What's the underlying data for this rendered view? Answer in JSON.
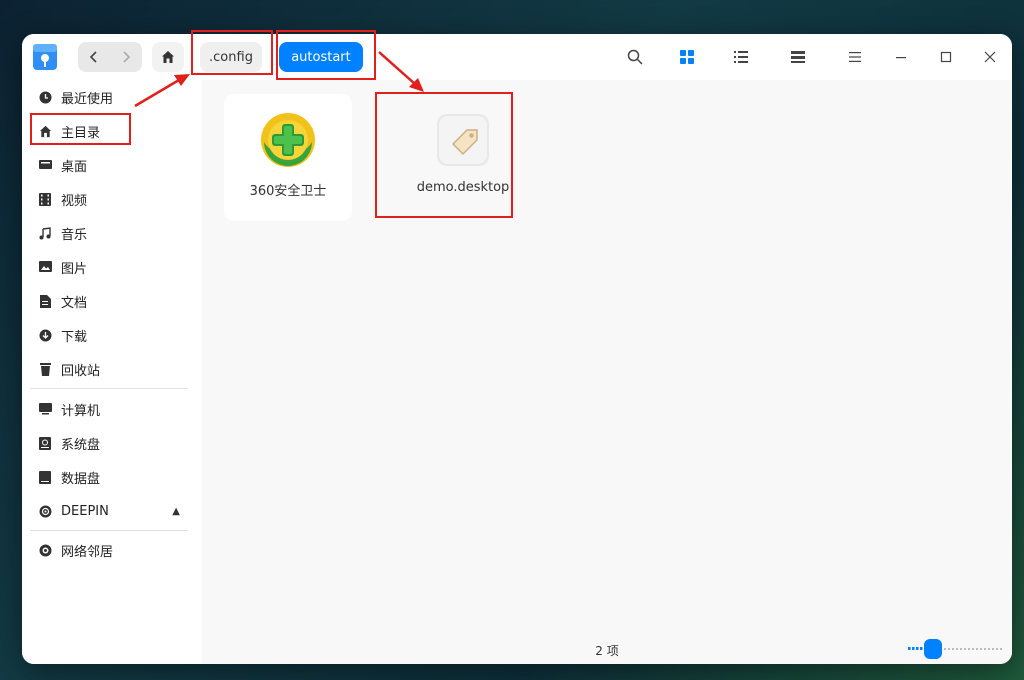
{
  "window": {
    "title": ""
  },
  "breadcrumb": {
    "config": ".config",
    "autostart": "autostart"
  },
  "toolbar": {
    "icons": [
      "search-icon",
      "grid-view-icon",
      "list-view-icon",
      "tree-view-icon",
      "menu-icon",
      "minimize-icon",
      "maximize-icon",
      "close-icon"
    ]
  },
  "sidebar": {
    "items": [
      {
        "label": "最近使用",
        "icon": "clock-icon"
      },
      {
        "label": "主目录",
        "icon": "home-icon"
      },
      {
        "label": "桌面",
        "icon": "desktop-icon"
      },
      {
        "label": "视频",
        "icon": "video-icon"
      },
      {
        "label": "音乐",
        "icon": "music-icon"
      },
      {
        "label": "图片",
        "icon": "picture-icon"
      },
      {
        "label": "文档",
        "icon": "document-icon"
      },
      {
        "label": "下载",
        "icon": "download-icon"
      },
      {
        "label": "回收站",
        "icon": "trash-icon"
      }
    ],
    "devices": [
      {
        "label": "计算机",
        "icon": "computer-icon"
      },
      {
        "label": "系统盘",
        "icon": "system-disk-icon"
      },
      {
        "label": "数据盘",
        "icon": "data-disk-icon"
      },
      {
        "label": "DEEPIN",
        "icon": "disc-icon"
      }
    ],
    "network": [
      {
        "label": "网络邻居",
        "icon": "network-icon"
      }
    ]
  },
  "files": [
    {
      "name": "360安全卫士",
      "icon": "360-security-icon",
      "selected": true
    },
    {
      "name": "demo.desktop",
      "icon": "desktop-file-icon",
      "selected": false
    }
  ],
  "status": {
    "count": "2 项"
  },
  "colors": {
    "accent": "#0081ff",
    "annotation": "#e0201c"
  }
}
